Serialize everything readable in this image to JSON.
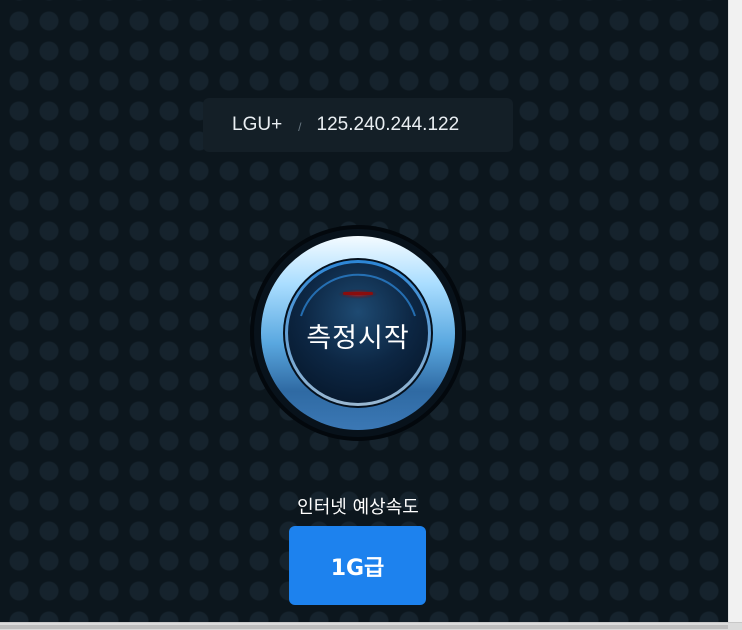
{
  "connection": {
    "isp": "LGU+",
    "separator": "/",
    "ip_address": "125.240.244.122"
  },
  "start_button": {
    "label": "측정시작"
  },
  "speed_estimate": {
    "caption": "인터넷 예상속도",
    "value": "1G급"
  },
  "colors": {
    "background": "#0c161d",
    "panel": "#141f27",
    "accent_blue": "#1d82ee",
    "ring_blue": "#8fd0ff",
    "indicator_red": "#a01414"
  }
}
